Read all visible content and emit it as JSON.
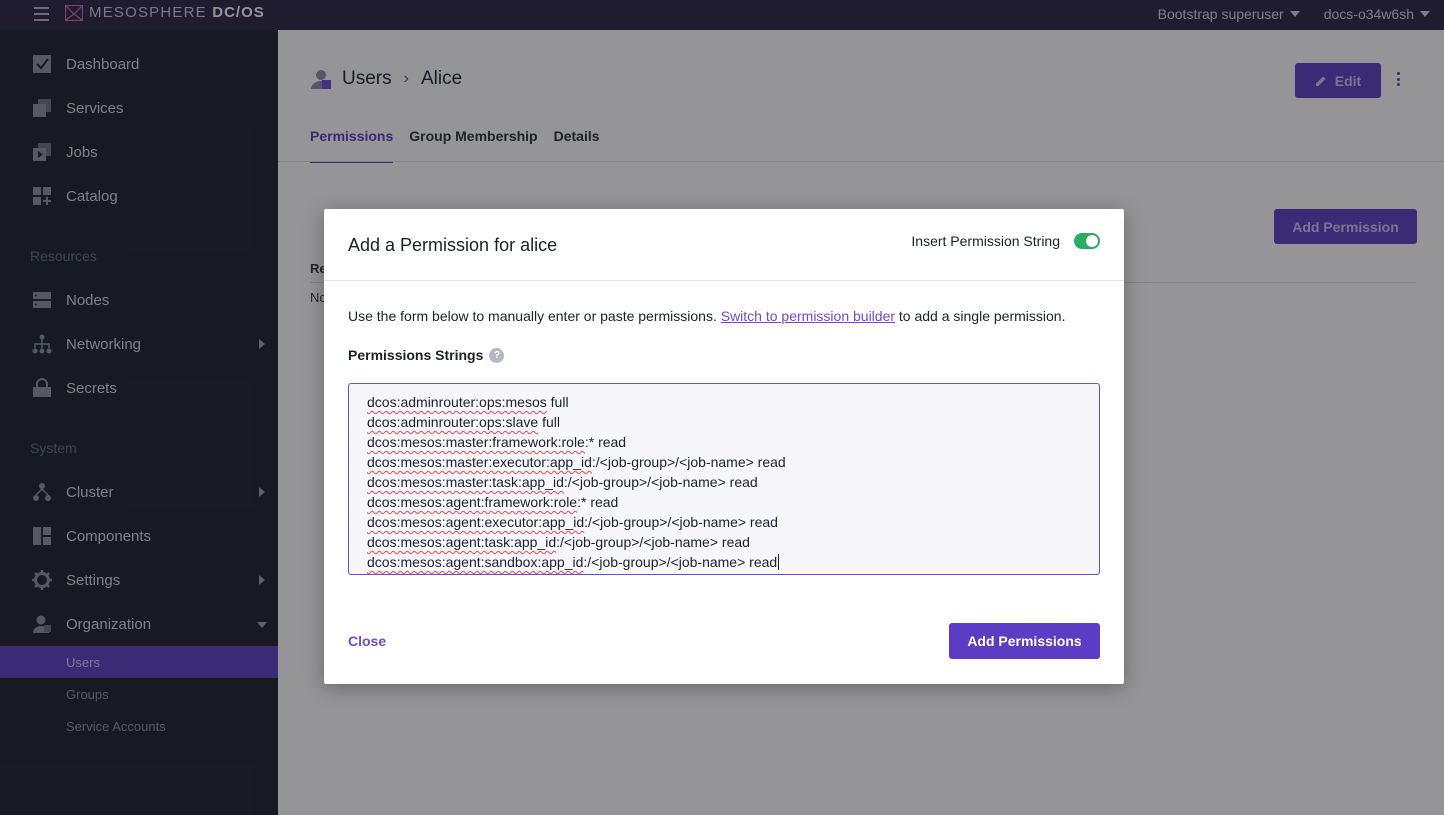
{
  "topbar": {
    "logo_light": "MESOSPHERE",
    "logo_bold": "DC/OS",
    "user_menu": "Bootstrap superuser",
    "cluster_menu": "docs-o34w6sh"
  },
  "sidebar": {
    "items": [
      {
        "label": "Dashboard",
        "icon": "dashboard-icon"
      },
      {
        "label": "Services",
        "icon": "services-icon"
      },
      {
        "label": "Jobs",
        "icon": "jobs-icon"
      },
      {
        "label": "Catalog",
        "icon": "catalog-icon"
      }
    ],
    "resources_label": "Resources",
    "resources": [
      {
        "label": "Nodes",
        "icon": "nodes-icon"
      },
      {
        "label": "Networking",
        "icon": "networking-icon"
      },
      {
        "label": "Secrets",
        "icon": "secrets-icon"
      }
    ],
    "system_label": "System",
    "system": [
      {
        "label": "Cluster",
        "icon": "cluster-icon"
      },
      {
        "label": "Components",
        "icon": "components-icon"
      },
      {
        "label": "Settings",
        "icon": "settings-icon"
      },
      {
        "label": "Organization",
        "icon": "organization-icon"
      }
    ],
    "organization_sub": [
      "Users",
      "Groups",
      "Service Accounts"
    ]
  },
  "main": {
    "breadcrumb": [
      "Users",
      "Alice"
    ],
    "edit_label": "Edit",
    "tabs": [
      "Permissions",
      "Group Membership",
      "Details"
    ],
    "add_permission_label": "Add Permission",
    "partial_header": "Re",
    "partial_row": "No"
  },
  "modal": {
    "title": "Add a Permission for alice",
    "toggle_label": "Insert Permission String",
    "toggle_on": true,
    "desc_before": "Use the form below to manually enter or paste permissions. ",
    "desc_link": "Switch to permission builder",
    "desc_after": " to add a single permission.",
    "field_label": "Permissions Strings",
    "lines": [
      {
        "id": "dcos:adminrouter:ops:mesos",
        "action": " full"
      },
      {
        "id": "dcos:adminrouter:ops:slave",
        "action": " full"
      },
      {
        "id": "dcos:mesos:master:framework:role",
        "action": ":* read"
      },
      {
        "id": "dcos:mesos:master:executor:app_id",
        "action": ":/<job-group>/<job-name> read"
      },
      {
        "id": "dcos:mesos:master:task:app_id",
        "action": ":/<job-group>/<job-name> read"
      },
      {
        "id": "dcos:mesos:agent:framework:role",
        "action": ":* read"
      },
      {
        "id": "dcos:mesos:agent:executor:app_id",
        "action": ":/<job-group>/<job-name> read"
      },
      {
        "id": "dcos:mesos:agent:task:app_id",
        "action": ":/<job-group>/<job-name> read"
      },
      {
        "id": "dcos:mesos:agent:sandbox:app_id",
        "action": ":/<job-group>/<job-name> read"
      }
    ],
    "close_label": "Close",
    "submit_label": "Add Permissions"
  },
  "colors": {
    "accent": "#5b3cc4",
    "topbar": "#2b2344",
    "sidebar": "#1b2029",
    "toggle_on": "#27ae60"
  }
}
